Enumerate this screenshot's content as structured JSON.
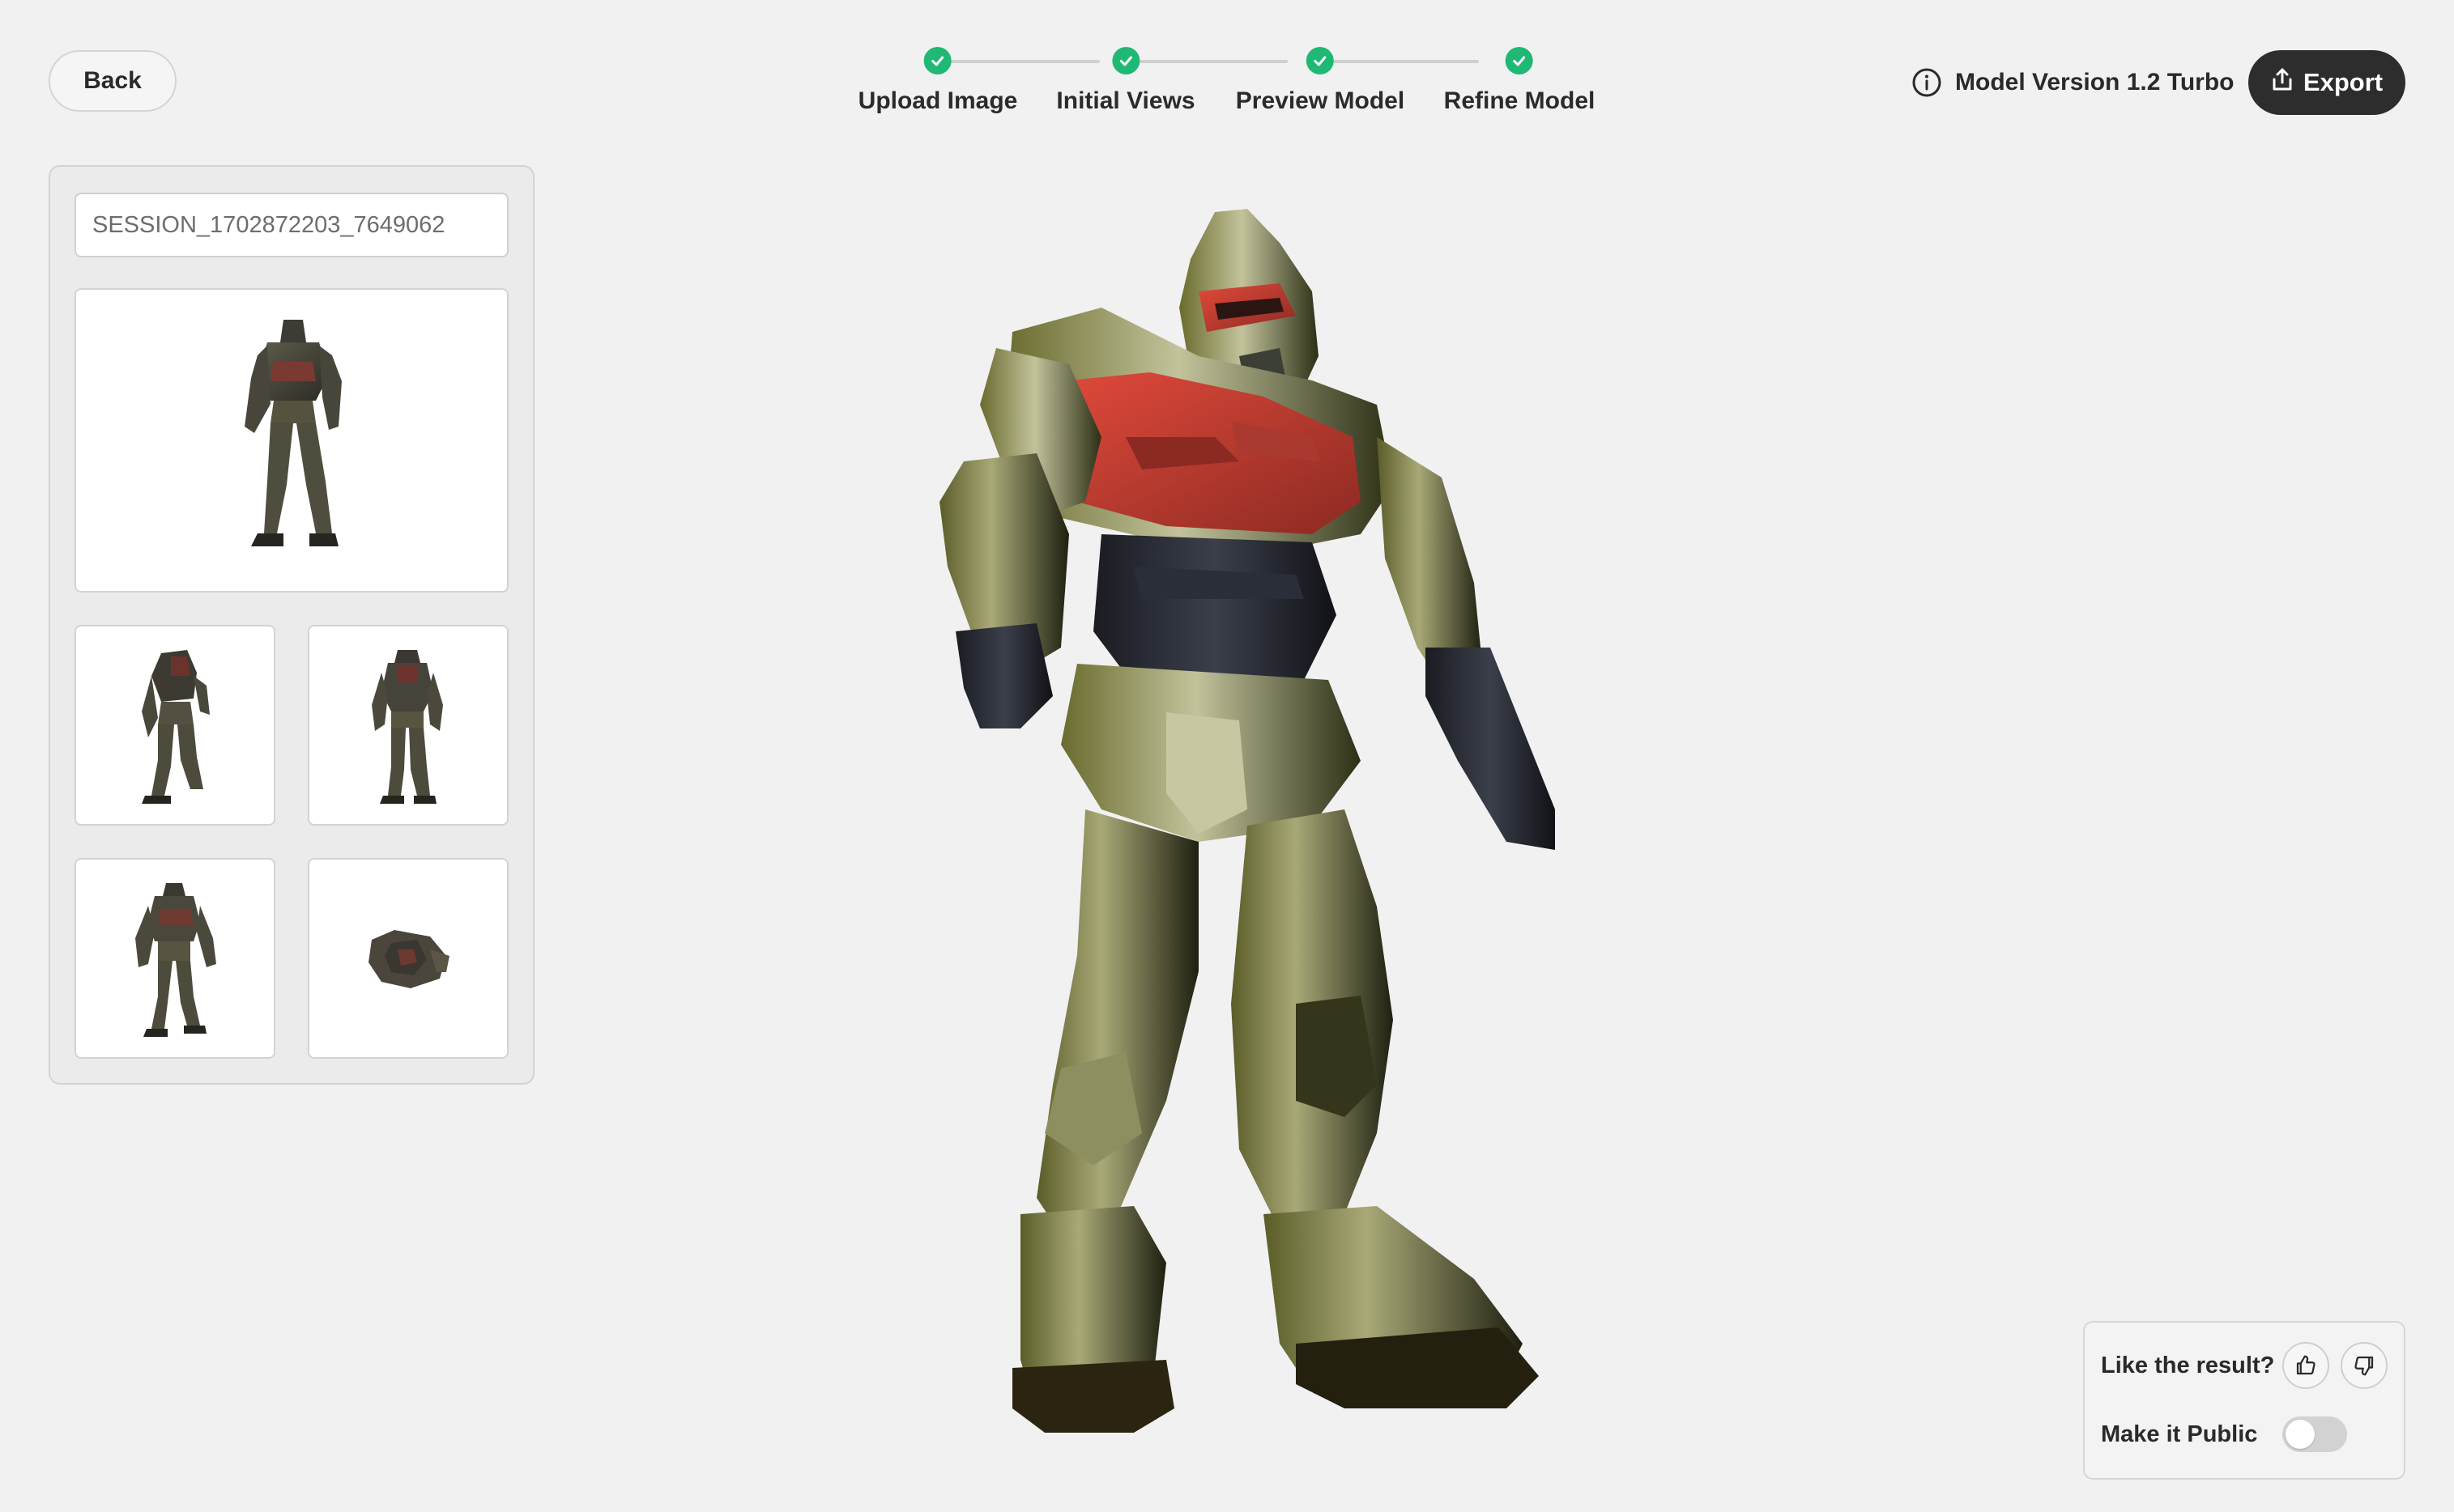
{
  "header": {
    "back_label": "Back",
    "model_version": "Model Version 1.2 Turbo",
    "export_label": "Export"
  },
  "steps": [
    {
      "label": "Upload Image",
      "status": "complete"
    },
    {
      "label": "Initial Views",
      "status": "complete"
    },
    {
      "label": "Preview Model",
      "status": "complete"
    },
    {
      "label": "Refine Model",
      "status": "complete"
    }
  ],
  "session": {
    "value": "SESSION_1702872203_7649062"
  },
  "views": [
    {
      "name": "main-view"
    },
    {
      "name": "back-view"
    },
    {
      "name": "rear-view"
    },
    {
      "name": "front-view"
    },
    {
      "name": "top-view"
    }
  ],
  "feedback": {
    "like_label": "Like the result?",
    "public_label": "Make it Public",
    "public_enabled": false
  },
  "colors": {
    "step_complete": "#1fb875",
    "export_bg": "#2d2d2d",
    "page_bg": "#f1f1f1"
  }
}
